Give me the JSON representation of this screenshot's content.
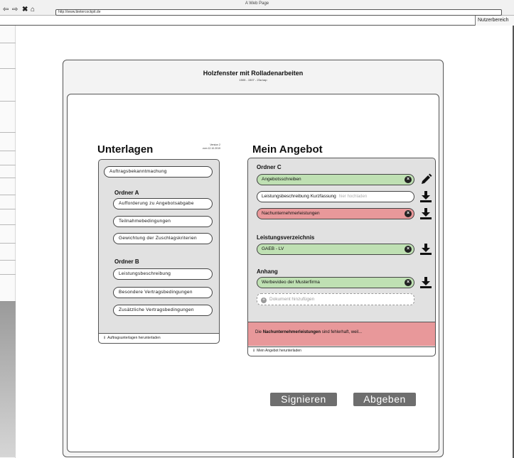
{
  "browser": {
    "window_title": "A Web Page",
    "address": "http://www.bietercockpit.de"
  },
  "header": {
    "user_area": "Nutzerbereich",
    "title": "Holzfenster mit Rolladenarbeiten",
    "subtitle": "1505 - 1507 - 23a kap"
  },
  "unterlagen": {
    "heading": "Unterlagen",
    "version": "Version 2",
    "version_date": "vom 12.10.2019",
    "top_doc": "Auftragsbekanntmachung",
    "folders": [
      {
        "label": "Ordner A",
        "docs": [
          "Aufforderung zu Angebotsabgabe",
          "Teilnahmebedingungen",
          "Gewichtung der Zuschlagskriterien"
        ]
      },
      {
        "label": "Ordner B",
        "docs": [
          "Leistungsbeschreibung",
          "Besondere Vertragsbedingungen",
          "Zusätzliche Vertragsbedingungen"
        ]
      }
    ],
    "download_label": "Auftragsunterlagen herunterladen"
  },
  "angebot": {
    "heading": "Mein Angebot",
    "sections": [
      {
        "label": "Ordner C",
        "slots": [
          {
            "label": "Angebotsschreiben",
            "status": "green",
            "action": "pencil-icon"
          },
          {
            "label": "Leistungsbeschreibung Kurzfassung",
            "placeholder": "hier hochladen",
            "status": "white",
            "action": "download-icon"
          },
          {
            "label": "Nachunternehmerleistungen",
            "status": "red",
            "action": "download-icon"
          }
        ]
      },
      {
        "label": "Leistungsverzeichnis",
        "slots": [
          {
            "label": "GAEB - LV",
            "status": "green",
            "action": "download-icon"
          }
        ]
      },
      {
        "label": "Anhang",
        "slots": [
          {
            "label": "Werbevideo der Musterfirma",
            "status": "green",
            "action": "download-icon"
          }
        ]
      }
    ],
    "add_document": "Dokument hinzufügen",
    "error": {
      "prefix": "Die",
      "highlight": "Nachunternehmerleistungen",
      "suffix": "sind fehlerhaft, weil..."
    },
    "download_label": "Mein Angebot herunterladen"
  },
  "actions": {
    "sign": "Signieren",
    "submit": "Abgeben"
  },
  "colors": {
    "ok": "#bfe0b3",
    "error": "#e8989a",
    "button": "#6e6e6e"
  }
}
